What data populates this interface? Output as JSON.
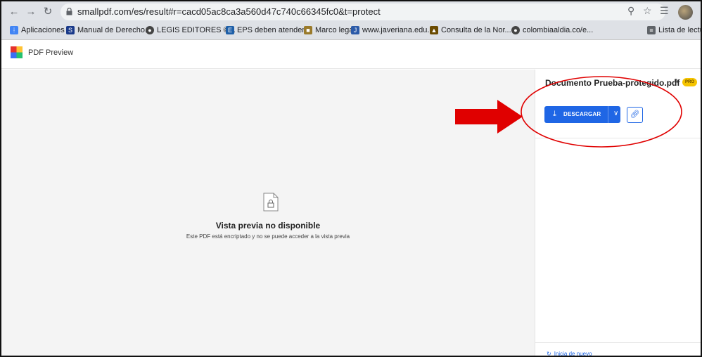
{
  "browser": {
    "url": "smallpdf.com/es/result#r=cacd05ac8ca3a560d47c740c66345fc0&t=protect",
    "bookmarks": [
      {
        "label": "Aplicaciones",
        "icon": "apps-grid-icon",
        "color": "#4285f4"
      },
      {
        "label": "Manual de Derecho...",
        "icon": "s-logo-icon",
        "color": "#1a3a8a"
      },
      {
        "label": "LEGIS EDITORES ©...",
        "icon": "globe-icon",
        "color": "#444444"
      },
      {
        "label": "EPS deben atender...",
        "icon": "news-icon",
        "color": "#1e5fa8"
      },
      {
        "label": "Marco legal",
        "icon": "page-icon",
        "color": "#9a7a2a"
      },
      {
        "label": "www.javeriana.edu...",
        "icon": "university-icon",
        "color": "#2b5aa8"
      },
      {
        "label": "Consulta de la Nor...",
        "icon": "shield-icon",
        "color": "#6b4b00"
      },
      {
        "label": "colombiaaldia.co/e...",
        "icon": "globe-icon",
        "color": "#444444"
      },
      {
        "label": "Lista de lectura",
        "icon": "reading-list-icon",
        "color": "#5f6368"
      }
    ]
  },
  "app": {
    "title": "PDF Preview"
  },
  "preview": {
    "title": "Vista previa no disponible",
    "subtitle": "Este PDF está encriptado y no se puede acceder a la vista previa"
  },
  "side": {
    "doc_name": "Documento Prueba-protegido.pdf",
    "badge": "PRO",
    "download_label": "DESCARGAR",
    "restart_label": "Inicia de nuevo"
  },
  "colors": {
    "accent": "#1f66e5",
    "pro_badge": "#f5c400",
    "annotation_red": "#e00000"
  }
}
